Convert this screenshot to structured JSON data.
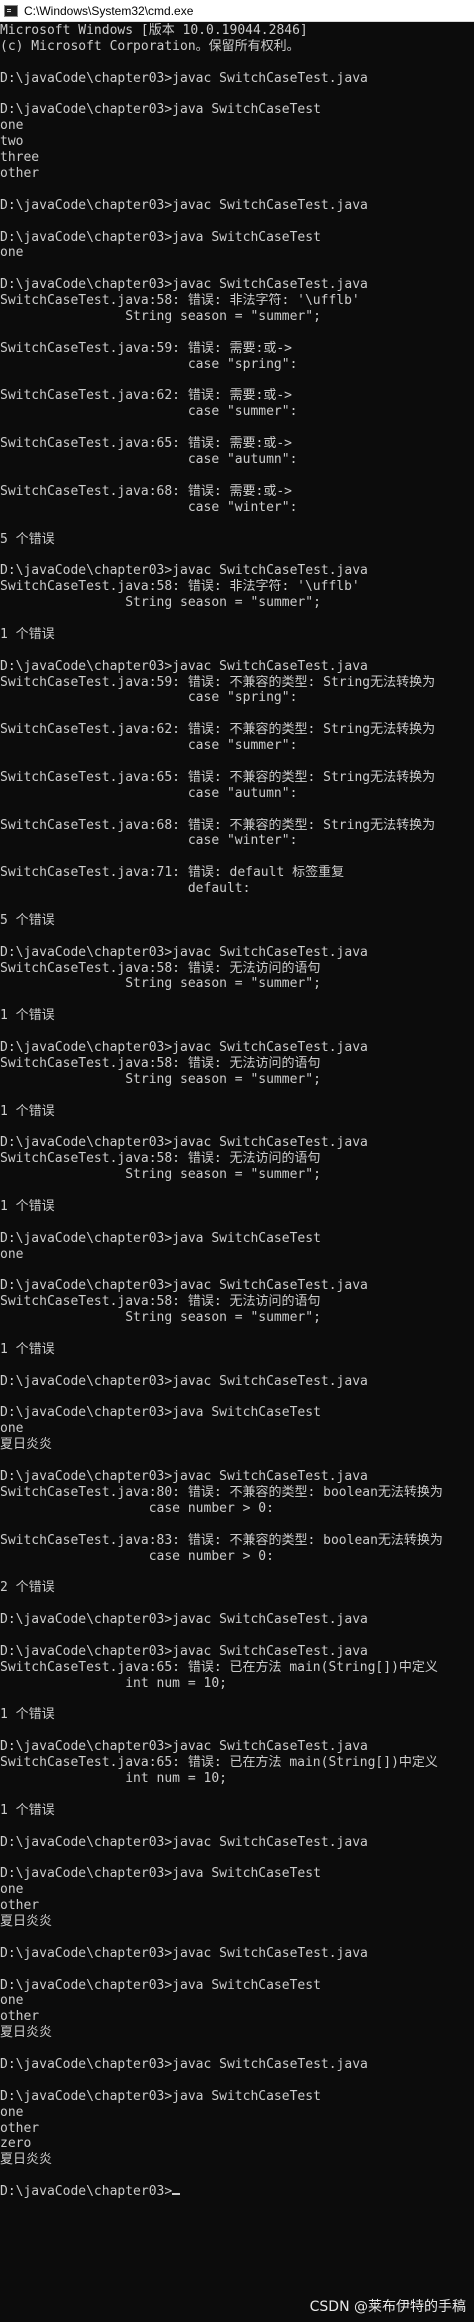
{
  "window": {
    "title": "C:\\Windows\\System32\\cmd.exe",
    "icon": "cmd-icon"
  },
  "console_lines": [
    "Microsoft Windows [版本 10.0.19044.2846]",
    "(c) Microsoft Corporation。保留所有权利。",
    "",
    "D:\\javaCode\\chapter03>javac SwitchCaseTest.java",
    "",
    "D:\\javaCode\\chapter03>java SwitchCaseTest",
    "one",
    "two",
    "three",
    "other",
    "",
    "D:\\javaCode\\chapter03>javac SwitchCaseTest.java",
    "",
    "D:\\javaCode\\chapter03>java SwitchCaseTest",
    "one",
    "",
    "D:\\javaCode\\chapter03>javac SwitchCaseTest.java",
    "SwitchCaseTest.java:58: 错误: 非法字符: '\\ufflb'",
    "                String season = \"summer\";",
    "",
    "SwitchCaseTest.java:59: 错误: 需要:或->",
    "                        case \"spring\":",
    "",
    "SwitchCaseTest.java:62: 错误: 需要:或->",
    "                        case \"summer\":",
    "",
    "SwitchCaseTest.java:65: 错误: 需要:或->",
    "                        case \"autumn\":",
    "",
    "SwitchCaseTest.java:68: 错误: 需要:或->",
    "                        case \"winter\":",
    "",
    "5 个错误",
    "",
    "D:\\javaCode\\chapter03>javac SwitchCaseTest.java",
    "SwitchCaseTest.java:58: 错误: 非法字符: '\\ufflb'",
    "                String season = \"summer\";",
    "",
    "1 个错误",
    "",
    "D:\\javaCode\\chapter03>javac SwitchCaseTest.java",
    "SwitchCaseTest.java:59: 错误: 不兼容的类型: String无法转换为",
    "                        case \"spring\":",
    "",
    "SwitchCaseTest.java:62: 错误: 不兼容的类型: String无法转换为",
    "                        case \"summer\":",
    "",
    "SwitchCaseTest.java:65: 错误: 不兼容的类型: String无法转换为",
    "                        case \"autumn\":",
    "",
    "SwitchCaseTest.java:68: 错误: 不兼容的类型: String无法转换为",
    "                        case \"winter\":",
    "",
    "SwitchCaseTest.java:71: 错误: default 标签重复",
    "                        default:",
    "",
    "5 个错误",
    "",
    "D:\\javaCode\\chapter03>javac SwitchCaseTest.java",
    "SwitchCaseTest.java:58: 错误: 无法访问的语句",
    "                String season = \"summer\";",
    "",
    "1 个错误",
    "",
    "D:\\javaCode\\chapter03>javac SwitchCaseTest.java",
    "SwitchCaseTest.java:58: 错误: 无法访问的语句",
    "                String season = \"summer\";",
    "",
    "1 个错误",
    "",
    "D:\\javaCode\\chapter03>javac SwitchCaseTest.java",
    "SwitchCaseTest.java:58: 错误: 无法访问的语句",
    "                String season = \"summer\";",
    "",
    "1 个错误",
    "",
    "D:\\javaCode\\chapter03>java SwitchCaseTest",
    "one",
    "",
    "D:\\javaCode\\chapter03>javac SwitchCaseTest.java",
    "SwitchCaseTest.java:58: 错误: 无法访问的语句",
    "                String season = \"summer\";",
    "",
    "1 个错误",
    "",
    "D:\\javaCode\\chapter03>javac SwitchCaseTest.java",
    "",
    "D:\\javaCode\\chapter03>java SwitchCaseTest",
    "one",
    "夏日炎炎",
    "",
    "D:\\javaCode\\chapter03>javac SwitchCaseTest.java",
    "SwitchCaseTest.java:80: 错误: 不兼容的类型: boolean无法转换为",
    "                   case number > 0:",
    "",
    "SwitchCaseTest.java:83: 错误: 不兼容的类型: boolean无法转换为",
    "                   case number > 0:",
    "",
    "2 个错误",
    "",
    "D:\\javaCode\\chapter03>javac SwitchCaseTest.java",
    "",
    "D:\\javaCode\\chapter03>javac SwitchCaseTest.java",
    "SwitchCaseTest.java:65: 错误: 已在方法 main(String[])中定义",
    "                int num = 10;",
    "",
    "1 个错误",
    "",
    "D:\\javaCode\\chapter03>javac SwitchCaseTest.java",
    "SwitchCaseTest.java:65: 错误: 已在方法 main(String[])中定义",
    "                int num = 10;",
    "",
    "1 个错误",
    "",
    "D:\\javaCode\\chapter03>javac SwitchCaseTest.java",
    "",
    "D:\\javaCode\\chapter03>java SwitchCaseTest",
    "one",
    "other",
    "夏日炎炎",
    "",
    "D:\\javaCode\\chapter03>javac SwitchCaseTest.java",
    "",
    "D:\\javaCode\\chapter03>java SwitchCaseTest",
    "one",
    "other",
    "夏日炎炎",
    "",
    "D:\\javaCode\\chapter03>javac SwitchCaseTest.java",
    "",
    "D:\\javaCode\\chapter03>java SwitchCaseTest",
    "one",
    "other",
    "zero",
    "夏日炎炎",
    "",
    "D:\\javaCode\\chapter03>"
  ],
  "watermark": "CSDN @莱布伊特的手稿",
  "colors": {
    "background": "#0c0c0c",
    "foreground": "#cccccc",
    "titlebar": "#ffffff"
  }
}
